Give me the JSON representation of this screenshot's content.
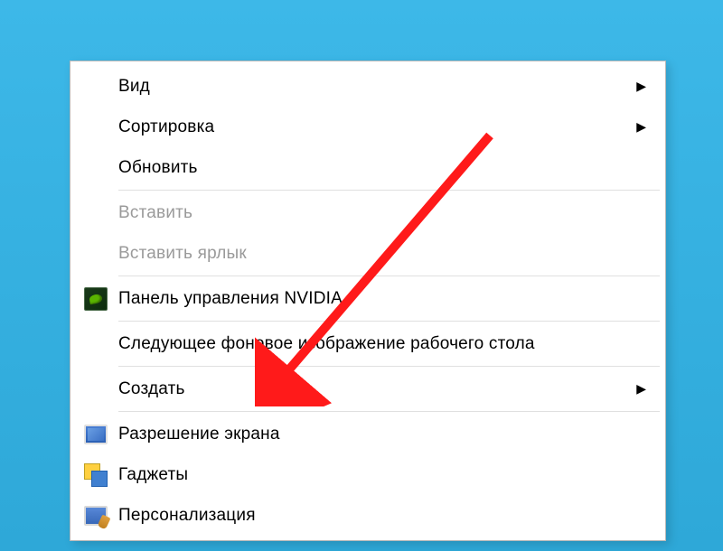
{
  "menu": {
    "items": {
      "view": {
        "label": "Вид",
        "hasSubmenu": true
      },
      "sort": {
        "label": "Сортировка",
        "hasSubmenu": true
      },
      "refresh": {
        "label": "Обновить"
      },
      "paste": {
        "label": "Вставить",
        "disabled": true
      },
      "paste_shortcut": {
        "label": "Вставить ярлык",
        "disabled": true
      },
      "nvidia": {
        "label": "Панель управления NVIDIA"
      },
      "next_wallpaper": {
        "label": "Следующее фоновое изображение рабочего стола"
      },
      "new": {
        "label": "Создать",
        "hasSubmenu": true
      },
      "resolution": {
        "label": "Разрешение экрана"
      },
      "gadgets": {
        "label": "Гаджеты"
      },
      "personalize": {
        "label": "Персонализация"
      }
    }
  }
}
